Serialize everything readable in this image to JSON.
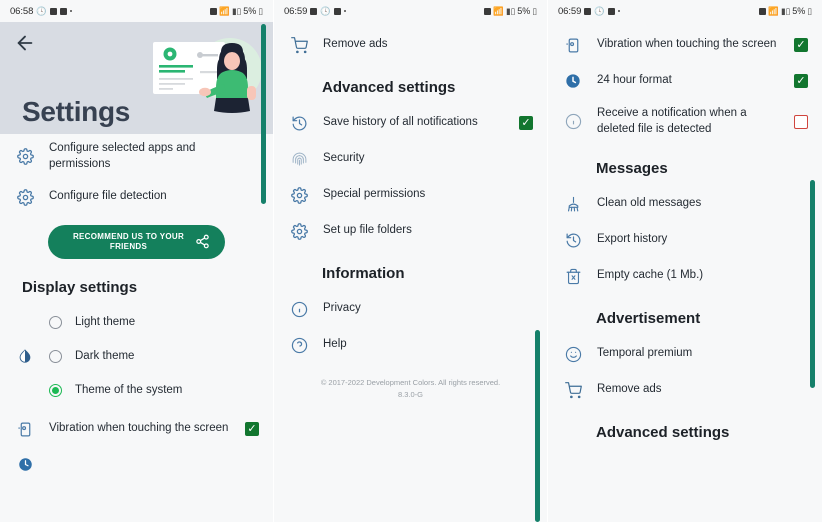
{
  "app": {
    "accent_green": "#14805c",
    "scrollbar_color": "#15806a",
    "icon_blue": "#4a7aa7",
    "header_bg": "#d8dce3",
    "check_on_color": "#12762f",
    "check_off_border": "#d0453e"
  },
  "panel1": {
    "status": {
      "time": "06:58",
      "battery": "5%"
    },
    "header": {
      "back_icon": "back-arrow-icon",
      "title": "Settings"
    },
    "items": [
      {
        "icon": "gear-icon",
        "label": "Configure selected apps and permissions"
      },
      {
        "icon": "gear-icon",
        "label": "Configure file detection"
      }
    ],
    "recommend_button": {
      "label": "RECOMMEND US TO YOUR FRIENDS",
      "icon": "share-icon"
    },
    "display_section": "Display settings",
    "themes": [
      {
        "label": "Light theme",
        "selected": false,
        "icon": ""
      },
      {
        "label": "Dark theme",
        "selected": false,
        "icon": "contrast-icon"
      },
      {
        "label": "Theme of the system",
        "selected": true,
        "icon": ""
      }
    ],
    "toggles": [
      {
        "icon": "vibration-phone-icon",
        "label": "Vibration when touching the screen",
        "checked": true
      }
    ]
  },
  "panel2": {
    "status": {
      "time": "06:59",
      "battery": "5%"
    },
    "top_item": {
      "icon": "cart-icon",
      "label": "Remove ads"
    },
    "advanced_section": "Advanced settings",
    "advanced_items": [
      {
        "icon": "history-icon",
        "label": "Save history of all notifications",
        "checked": true
      },
      {
        "icon": "fingerprint-icon",
        "label": "Security"
      },
      {
        "icon": "gear-icon",
        "label": "Special permissions"
      },
      {
        "icon": "gear-icon",
        "label": "Set up file folders"
      }
    ],
    "information_section": "Information",
    "information_items": [
      {
        "icon": "info-icon",
        "label": "Privacy"
      },
      {
        "icon": "help-icon",
        "label": "Help"
      }
    ],
    "footer_line1": "© 2017-2022 Development Colors. All rights reserved.",
    "footer_line2": "8.3.0-G"
  },
  "panel3": {
    "status": {
      "time": "06:59",
      "battery": "5%"
    },
    "toggles": [
      {
        "icon": "vibration-phone-icon",
        "label": "Vibration when touching the screen",
        "checked": true
      },
      {
        "icon": "clock-filled-icon",
        "label": "24 hour format",
        "checked": true
      },
      {
        "icon": "info-icon",
        "label": "Receive a notification when a deleted file is detected",
        "checked": false
      }
    ],
    "messages_section": "Messages",
    "messages_items": [
      {
        "icon": "broom-icon",
        "label": "Clean old messages"
      },
      {
        "icon": "history-icon",
        "label": "Export history"
      },
      {
        "icon": "trash-icon",
        "label": "Empty cache  (1 Mb.)"
      }
    ],
    "advertisement_section": "Advertisement",
    "advertisement_items": [
      {
        "icon": "smiley-icon",
        "label": "Temporal premium"
      },
      {
        "icon": "cart-icon",
        "label": "Remove ads"
      }
    ],
    "advanced_section": "Advanced settings"
  }
}
